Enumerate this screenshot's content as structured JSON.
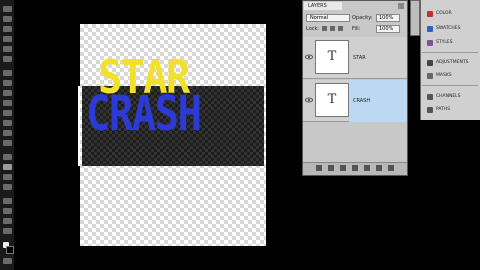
{
  "canvas": {
    "text_top": "STAR",
    "text_bottom": "CRASH",
    "colors": {
      "star": "#f2e02a",
      "crash": "#2c3ad6"
    }
  },
  "layers_panel": {
    "tab_label": "LAYERS",
    "blend_mode": "Normal",
    "opacity_label": "Opacity:",
    "opacity_value": "100%",
    "lock_label": "Lock:",
    "fill_label": "Fill:",
    "fill_value": "100%",
    "layers": [
      {
        "name": "STAR",
        "thumb_glyph": "T",
        "selected": false
      },
      {
        "name": "CRASH",
        "thumb_glyph": "T",
        "selected": true
      }
    ]
  },
  "dock": {
    "items": [
      "COLOR",
      "SWATCHES",
      "STYLES",
      "ADJUSTMENTS",
      "MASKS",
      "CHANNELS",
      "PATHS"
    ]
  },
  "icons": [
    "eye-icon",
    "text-layer-icon",
    "link-icon",
    "fx-icon",
    "mask-icon",
    "adjustment-icon",
    "folder-icon",
    "new-layer-icon",
    "trash-icon"
  ]
}
